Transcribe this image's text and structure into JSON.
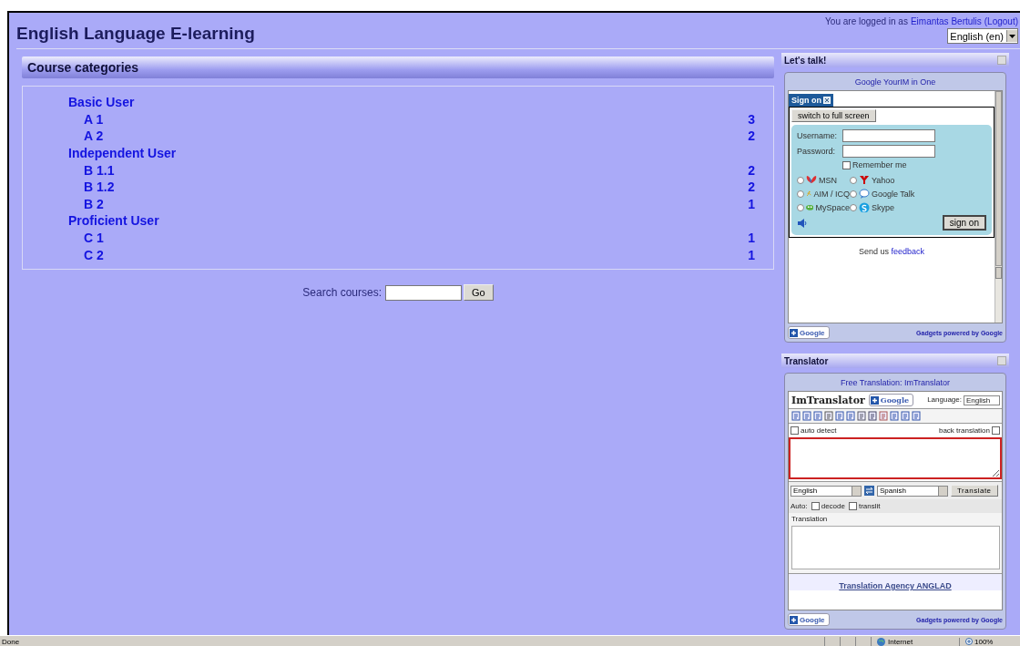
{
  "site_title": "English Language E-learning",
  "login": {
    "prefix": "You are logged in as",
    "user": "Eimantas Bertulis",
    "logout": "(Logout)"
  },
  "language_select": "English (en)",
  "course_categories": {
    "title": "Course categories",
    "categories": [
      {
        "name": "Basic User",
        "children": [
          {
            "name": "A 1",
            "count": "3"
          },
          {
            "name": "A 2",
            "count": "2"
          }
        ]
      },
      {
        "name": "Independent User",
        "children": [
          {
            "name": "B 1.1",
            "count": "2"
          },
          {
            "name": "B 1.2",
            "count": "2"
          },
          {
            "name": "B 2",
            "count": "1"
          }
        ]
      },
      {
        "name": "Proficient User",
        "children": [
          {
            "name": "C 1",
            "count": "1"
          },
          {
            "name": "C 2",
            "count": "1"
          }
        ]
      }
    ]
  },
  "search": {
    "label": "Search courses:",
    "button": "Go"
  },
  "im_block": {
    "title": "Let's talk!",
    "heading": "Google YourIM in One",
    "tab": "Sign on",
    "fullscreen_button": "switch to full screen",
    "username_label": "Username:",
    "password_label": "Password:",
    "remember": {
      "label": "Remember me",
      "checked": false
    },
    "networks": [
      {
        "name": "MSN",
        "selected": false
      },
      {
        "name": "Yahoo",
        "selected": false
      },
      {
        "name": "AIM / ICQ",
        "selected": false
      },
      {
        "name": "Google Talk",
        "selected": false
      },
      {
        "name": "MySpace",
        "selected": false
      },
      {
        "name": "Skype",
        "selected": false
      }
    ],
    "sign_on_button": "sign on",
    "feedback_prefix": "Send us",
    "feedback_link": "feedback",
    "google_button": "Google",
    "powered": "Gadgets powered by Google"
  },
  "translator_block": {
    "title": "Translator",
    "heading": "Free Translation: ImTranslator",
    "brand": "ImTranslator",
    "google_button": "Google",
    "language_label": "Language:",
    "language_value": "English",
    "auto_detect": {
      "label": "auto detect",
      "checked": false
    },
    "back_translation": {
      "label": "back translation",
      "checked": false
    },
    "from": "English",
    "to": "Spanish",
    "translate_button": "Translate",
    "auto_label": "Auto:",
    "options": [
      {
        "label": "decode",
        "checked": false
      },
      {
        "label": "translit",
        "checked": false
      }
    ],
    "translation_label": "Translation",
    "agency_link": "Translation Agency ANGLAD",
    "google_button_2": "Google",
    "powered": "Gadgets powered by Google"
  },
  "status_bar": {
    "text": "Done",
    "zone": "Internet",
    "zoom": "100%"
  }
}
